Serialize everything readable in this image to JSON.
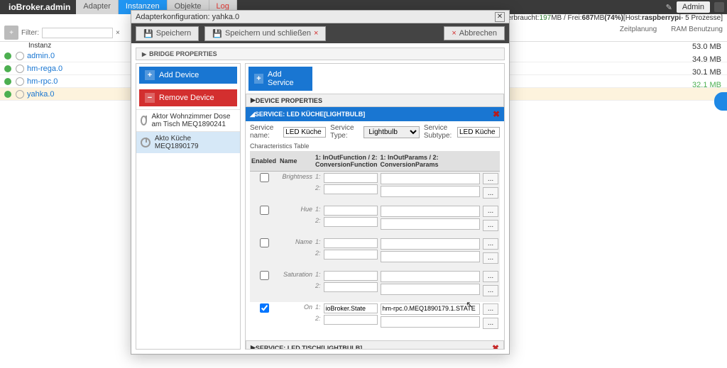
{
  "header": {
    "brand": "ioBroker.admin",
    "tabs": [
      "Adapter",
      "Instanzen",
      "Objekte",
      "Log"
    ],
    "active_tab": 1,
    "admin_label": "Admin"
  },
  "infostrip": {
    "prefix": "RAM verbraucht: ",
    "used": "197",
    "mb1": " MB / Frei: ",
    "free": "687",
    "mb2": " MB ",
    "pct": "(74%)",
    "host_pre": " [Host: ",
    "host": "raspberrypi",
    "host_post": " - 5 Prozesse]"
  },
  "columns": {
    "zeit": "Zeitplanung",
    "ram": "RAM Benutzung"
  },
  "filter": {
    "label": "Filter:",
    "value": "",
    "clear": "×"
  },
  "instanz_label": "Instanz",
  "instances": [
    {
      "name": "admin.0",
      "ram": "53.0 MB"
    },
    {
      "name": "hm-rega.0",
      "ram": "34.9 MB"
    },
    {
      "name": "hm-rpc.0",
      "ram": "30.1 MB"
    },
    {
      "name": "yahka.0",
      "ram": "32.1 MB",
      "selected": true
    }
  ],
  "dialog": {
    "title": "Adapterkonfiguration: yahka.0",
    "save": "Speichern",
    "save_close": "Speichern und schließen",
    "cancel": "Abbrechen",
    "bridge": "BRIDGE PROPERTIES",
    "add_device": "Add Device",
    "remove_device": "Remove Device",
    "add_service": "Add Service",
    "dev_props": "DEVICE PROPERTIES",
    "devices": [
      "Aktor Wohnzimmer Dose am Tisch MEQ1890241",
      "Akto Küche MEQ1890179"
    ],
    "svc1_title": "SERVICE: LED KÜCHE[LIGHTBULB]",
    "svc2_title": "SERVICE: LED TISCH[LIGHTBULB]",
    "form": {
      "svc_name_lbl": "Service name:",
      "svc_name": "LED Küche",
      "svc_type_lbl": "Service Type:",
      "svc_type": "Lightbulb",
      "svc_sub_lbl": "Service Subtype:",
      "svc_sub": "LED Küche",
      "char_table_lbl": "Characteristics Table"
    },
    "th": {
      "enabled": "Enabled",
      "name": "Name",
      "inout": "1: InOutFunction / 2: ConversionFunction",
      "params": "1: InOutParams / 2: ConversionParams"
    },
    "rows": [
      {
        "name": "Brightness",
        "enabled": false
      },
      {
        "name": "Hue",
        "enabled": false
      },
      {
        "name": "Name",
        "enabled": false
      },
      {
        "name": "Saturation",
        "enabled": false
      },
      {
        "name": "On",
        "enabled": true,
        "fn1": "ioBroker.State",
        "param1": "hm-rpc.0.MEQ1890179.1.STATE"
      }
    ],
    "row_sub": {
      "l1": "1:",
      "l2": "2:"
    },
    "dots": "..."
  }
}
